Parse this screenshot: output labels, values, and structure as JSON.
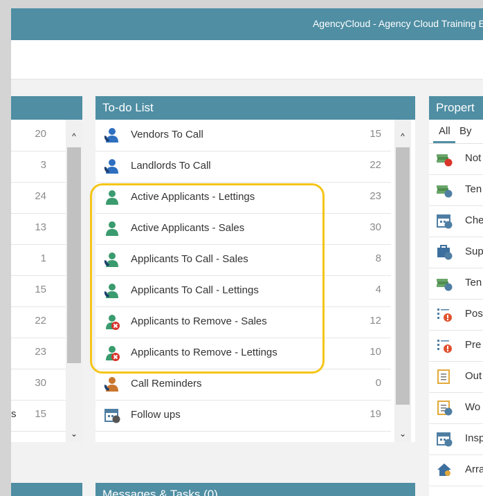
{
  "window": {
    "title": "AgencyCloud - Agency Cloud Training E"
  },
  "left_panel": {
    "rows": [
      {
        "count": "20"
      },
      {
        "count": "3"
      },
      {
        "count": "24"
      },
      {
        "count": "13"
      },
      {
        "count": "1"
      },
      {
        "count": "15"
      },
      {
        "count": "22"
      },
      {
        "count": "23"
      },
      {
        "count": "30"
      },
      {
        "count": "15",
        "fragment": "s"
      }
    ]
  },
  "todo": {
    "title": "To-do List",
    "items": [
      {
        "label": "Vendors To Call",
        "count": "15",
        "icon": "person-phone-icon",
        "color": "#2f6fbf"
      },
      {
        "label": "Landlords To Call",
        "count": "22",
        "icon": "person-phone-icon",
        "color": "#2f6fbf"
      },
      {
        "label": "Active Applicants - Lettings",
        "count": "23",
        "icon": "person-icon",
        "color": "#3a9b6e"
      },
      {
        "label": "Active Applicants - Sales",
        "count": "30",
        "icon": "person-icon",
        "color": "#3a9b6e"
      },
      {
        "label": "Applicants To Call - Sales",
        "count": "8",
        "icon": "person-phone-icon",
        "color": "#3a9b6e"
      },
      {
        "label": "Applicants To Call - Lettings",
        "count": "4",
        "icon": "person-phone-icon",
        "color": "#3a9b6e"
      },
      {
        "label": "Applicants to Remove - Sales",
        "count": "12",
        "icon": "person-remove-icon",
        "color": "#3a9b6e"
      },
      {
        "label": "Applicants to Remove - Lettings",
        "count": "10",
        "icon": "person-remove-icon",
        "color": "#3a9b6e"
      },
      {
        "label": "Call Reminders",
        "count": "0",
        "icon": "person-phone-icon",
        "color": "#c9772e"
      },
      {
        "label": "Follow ups",
        "count": "19",
        "icon": "calendar-question-icon",
        "color": "#4f7ea3"
      }
    ]
  },
  "properties": {
    "title": "Propert",
    "tabs": [
      "All",
      "By"
    ],
    "items": [
      {
        "label": "Not",
        "icon": "money-remove-icon"
      },
      {
        "label": "Ten",
        "icon": "money-clock-icon"
      },
      {
        "label": "Che",
        "icon": "calendar-arrow-icon"
      },
      {
        "label": "Sup",
        "icon": "toolbox-clock-icon"
      },
      {
        "label": "Ten",
        "icon": "money-refresh-icon"
      },
      {
        "label": "Pos",
        "icon": "list-alert-icon"
      },
      {
        "label": "Pre",
        "icon": "list-alert-icon"
      },
      {
        "label": "Out",
        "icon": "clipboard-icon"
      },
      {
        "label": "Wo",
        "icon": "clipboard-clock-icon"
      },
      {
        "label": "Insp",
        "icon": "calendar-clock-icon"
      },
      {
        "label": "Arra",
        "icon": "house-key-icon"
      }
    ]
  },
  "messages": {
    "title": "Messages & Tasks (0)"
  },
  "colors": {
    "accent": "#4f8ea3",
    "highlight": "#f5c518",
    "remove_badge": "#d9342b"
  }
}
